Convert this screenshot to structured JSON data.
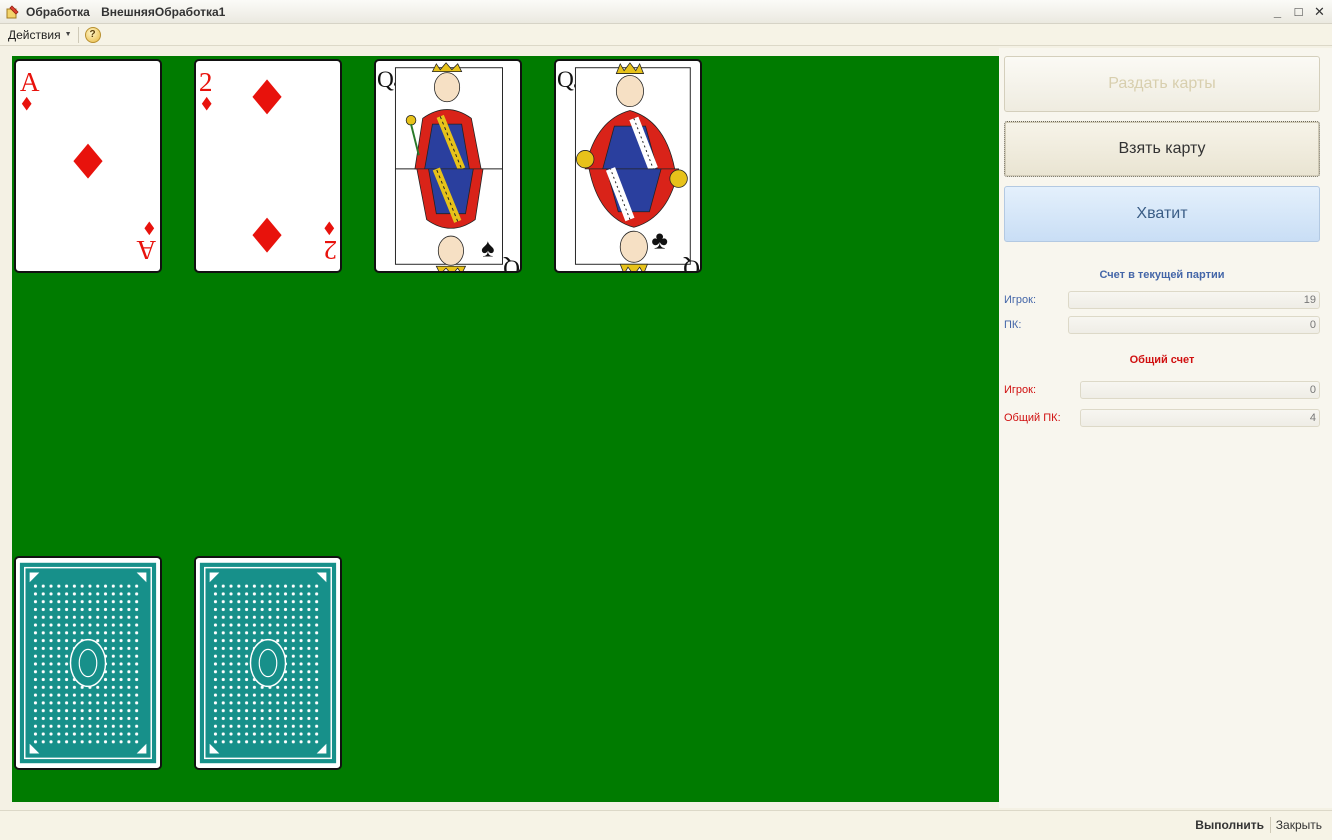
{
  "window": {
    "title": "Обработка",
    "subtitle": "ВнешняяОбработка1",
    "minimize": "_",
    "maximize": "□",
    "close": "✕"
  },
  "toolbar": {
    "actions_label": "Действия",
    "help_label": "?"
  },
  "table": {
    "opponent_cards": [
      {
        "rank": "A",
        "suit": "diamonds",
        "suit_glyph": "♦",
        "color": "#e8120c"
      },
      {
        "rank": "2",
        "suit": "diamonds",
        "suit_glyph": "♦",
        "color": "#e8120c"
      },
      {
        "rank": "Q",
        "suit": "spades",
        "suit_glyph": "♠",
        "color": "#111111"
      },
      {
        "rank": "Q",
        "suit": "clubs",
        "suit_glyph": "♣",
        "color": "#111111"
      }
    ],
    "player_cards_face_down": 2,
    "felt_color": "#007b00",
    "card_back_color": "#17908a"
  },
  "buttons": {
    "deal": "Раздать карты",
    "take": "Взять карту",
    "enough": "Хватит"
  },
  "score_current": {
    "title": "Счет в текущей партии",
    "player_label": "Игрок:",
    "player_value": "19",
    "pc_label": "ПК:",
    "pc_value": "0"
  },
  "score_total": {
    "title": "Общий счет",
    "player_label": "Игрок:",
    "player_value": "0",
    "pc_label": "Общий ПК:",
    "pc_value": "4"
  },
  "footer": {
    "execute": "Выполнить",
    "close": "Закрыть"
  }
}
